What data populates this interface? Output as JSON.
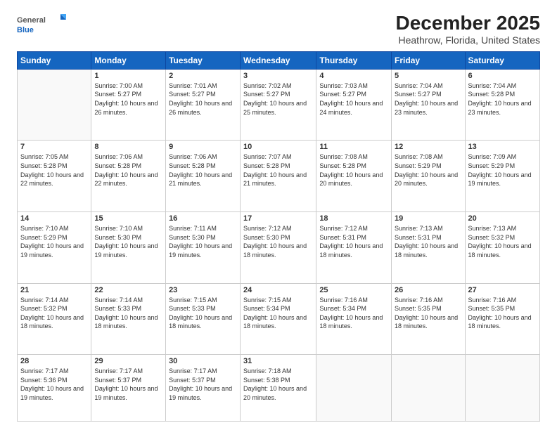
{
  "logo": {
    "general": "General",
    "blue": "Blue"
  },
  "header": {
    "month": "December 2025",
    "location": "Heathrow, Florida, United States"
  },
  "weekdays": [
    "Sunday",
    "Monday",
    "Tuesday",
    "Wednesday",
    "Thursday",
    "Friday",
    "Saturday"
  ],
  "weeks": [
    [
      {
        "day": "",
        "sunrise": "",
        "sunset": "",
        "daylight": ""
      },
      {
        "day": "1",
        "sunrise": "Sunrise: 7:00 AM",
        "sunset": "Sunset: 5:27 PM",
        "daylight": "Daylight: 10 hours and 26 minutes."
      },
      {
        "day": "2",
        "sunrise": "Sunrise: 7:01 AM",
        "sunset": "Sunset: 5:27 PM",
        "daylight": "Daylight: 10 hours and 26 minutes."
      },
      {
        "day": "3",
        "sunrise": "Sunrise: 7:02 AM",
        "sunset": "Sunset: 5:27 PM",
        "daylight": "Daylight: 10 hours and 25 minutes."
      },
      {
        "day": "4",
        "sunrise": "Sunrise: 7:03 AM",
        "sunset": "Sunset: 5:27 PM",
        "daylight": "Daylight: 10 hours and 24 minutes."
      },
      {
        "day": "5",
        "sunrise": "Sunrise: 7:04 AM",
        "sunset": "Sunset: 5:27 PM",
        "daylight": "Daylight: 10 hours and 23 minutes."
      },
      {
        "day": "6",
        "sunrise": "Sunrise: 7:04 AM",
        "sunset": "Sunset: 5:28 PM",
        "daylight": "Daylight: 10 hours and 23 minutes."
      }
    ],
    [
      {
        "day": "7",
        "sunrise": "Sunrise: 7:05 AM",
        "sunset": "Sunset: 5:28 PM",
        "daylight": "Daylight: 10 hours and 22 minutes."
      },
      {
        "day": "8",
        "sunrise": "Sunrise: 7:06 AM",
        "sunset": "Sunset: 5:28 PM",
        "daylight": "Daylight: 10 hours and 22 minutes."
      },
      {
        "day": "9",
        "sunrise": "Sunrise: 7:06 AM",
        "sunset": "Sunset: 5:28 PM",
        "daylight": "Daylight: 10 hours and 21 minutes."
      },
      {
        "day": "10",
        "sunrise": "Sunrise: 7:07 AM",
        "sunset": "Sunset: 5:28 PM",
        "daylight": "Daylight: 10 hours and 21 minutes."
      },
      {
        "day": "11",
        "sunrise": "Sunrise: 7:08 AM",
        "sunset": "Sunset: 5:28 PM",
        "daylight": "Daylight: 10 hours and 20 minutes."
      },
      {
        "day": "12",
        "sunrise": "Sunrise: 7:08 AM",
        "sunset": "Sunset: 5:29 PM",
        "daylight": "Daylight: 10 hours and 20 minutes."
      },
      {
        "day": "13",
        "sunrise": "Sunrise: 7:09 AM",
        "sunset": "Sunset: 5:29 PM",
        "daylight": "Daylight: 10 hours and 19 minutes."
      }
    ],
    [
      {
        "day": "14",
        "sunrise": "Sunrise: 7:10 AM",
        "sunset": "Sunset: 5:29 PM",
        "daylight": "Daylight: 10 hours and 19 minutes."
      },
      {
        "day": "15",
        "sunrise": "Sunrise: 7:10 AM",
        "sunset": "Sunset: 5:30 PM",
        "daylight": "Daylight: 10 hours and 19 minutes."
      },
      {
        "day": "16",
        "sunrise": "Sunrise: 7:11 AM",
        "sunset": "Sunset: 5:30 PM",
        "daylight": "Daylight: 10 hours and 19 minutes."
      },
      {
        "day": "17",
        "sunrise": "Sunrise: 7:12 AM",
        "sunset": "Sunset: 5:30 PM",
        "daylight": "Daylight: 10 hours and 18 minutes."
      },
      {
        "day": "18",
        "sunrise": "Sunrise: 7:12 AM",
        "sunset": "Sunset: 5:31 PM",
        "daylight": "Daylight: 10 hours and 18 minutes."
      },
      {
        "day": "19",
        "sunrise": "Sunrise: 7:13 AM",
        "sunset": "Sunset: 5:31 PM",
        "daylight": "Daylight: 10 hours and 18 minutes."
      },
      {
        "day": "20",
        "sunrise": "Sunrise: 7:13 AM",
        "sunset": "Sunset: 5:32 PM",
        "daylight": "Daylight: 10 hours and 18 minutes."
      }
    ],
    [
      {
        "day": "21",
        "sunrise": "Sunrise: 7:14 AM",
        "sunset": "Sunset: 5:32 PM",
        "daylight": "Daylight: 10 hours and 18 minutes."
      },
      {
        "day": "22",
        "sunrise": "Sunrise: 7:14 AM",
        "sunset": "Sunset: 5:33 PM",
        "daylight": "Daylight: 10 hours and 18 minutes."
      },
      {
        "day": "23",
        "sunrise": "Sunrise: 7:15 AM",
        "sunset": "Sunset: 5:33 PM",
        "daylight": "Daylight: 10 hours and 18 minutes."
      },
      {
        "day": "24",
        "sunrise": "Sunrise: 7:15 AM",
        "sunset": "Sunset: 5:34 PM",
        "daylight": "Daylight: 10 hours and 18 minutes."
      },
      {
        "day": "25",
        "sunrise": "Sunrise: 7:16 AM",
        "sunset": "Sunset: 5:34 PM",
        "daylight": "Daylight: 10 hours and 18 minutes."
      },
      {
        "day": "26",
        "sunrise": "Sunrise: 7:16 AM",
        "sunset": "Sunset: 5:35 PM",
        "daylight": "Daylight: 10 hours and 18 minutes."
      },
      {
        "day": "27",
        "sunrise": "Sunrise: 7:16 AM",
        "sunset": "Sunset: 5:35 PM",
        "daylight": "Daylight: 10 hours and 18 minutes."
      }
    ],
    [
      {
        "day": "28",
        "sunrise": "Sunrise: 7:17 AM",
        "sunset": "Sunset: 5:36 PM",
        "daylight": "Daylight: 10 hours and 19 minutes."
      },
      {
        "day": "29",
        "sunrise": "Sunrise: 7:17 AM",
        "sunset": "Sunset: 5:37 PM",
        "daylight": "Daylight: 10 hours and 19 minutes."
      },
      {
        "day": "30",
        "sunrise": "Sunrise: 7:17 AM",
        "sunset": "Sunset: 5:37 PM",
        "daylight": "Daylight: 10 hours and 19 minutes."
      },
      {
        "day": "31",
        "sunrise": "Sunrise: 7:18 AM",
        "sunset": "Sunset: 5:38 PM",
        "daylight": "Daylight: 10 hours and 20 minutes."
      },
      {
        "day": "",
        "sunrise": "",
        "sunset": "",
        "daylight": ""
      },
      {
        "day": "",
        "sunrise": "",
        "sunset": "",
        "daylight": ""
      },
      {
        "day": "",
        "sunrise": "",
        "sunset": "",
        "daylight": ""
      }
    ]
  ]
}
